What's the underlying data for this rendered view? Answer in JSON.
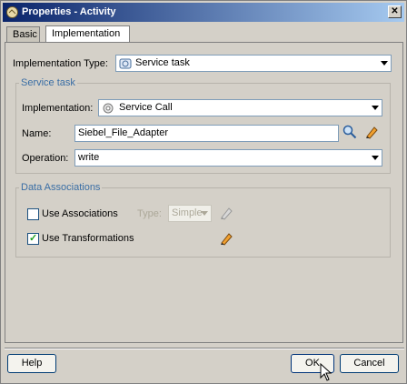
{
  "window": {
    "title": "Properties - Activity",
    "close_glyph": "✕"
  },
  "tabs": [
    {
      "label": "Basic"
    },
    {
      "label": "Implementation"
    }
  ],
  "implementation_type": {
    "label": "Implementation Type:",
    "value": "Service task"
  },
  "service_task": {
    "group_title": "Service task",
    "implementation_label": "Implementation:",
    "implementation_value": "Service Call",
    "name_label": "Name:",
    "name_value": "Siebel_File_Adapter",
    "operation_label": "Operation:",
    "operation_value": "write"
  },
  "data_associations": {
    "group_title": "Data Associations",
    "use_associations_label": "Use Associations",
    "use_associations_checked": false,
    "type_label": "Type:",
    "type_value": "Simple",
    "use_transformations_label": "Use Transformations",
    "use_transformations_checked": true
  },
  "footer": {
    "help_label": "Help",
    "ok_label": "OK",
    "cancel_label": "Cancel"
  },
  "icons": {
    "search": "magnifier-icon",
    "edit": "pencil-icon"
  },
  "colors": {
    "group_title": "#3a6ea5",
    "title_start": "#0a246a",
    "title_end": "#a6caf0"
  }
}
